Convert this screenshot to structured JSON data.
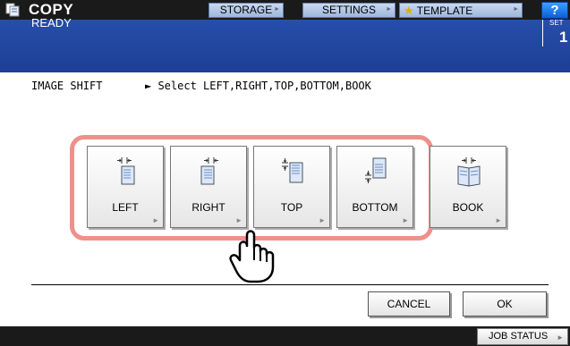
{
  "header": {
    "title": "COPY",
    "buttons": [
      {
        "label": "STORAGE",
        "has_arrow": true
      },
      {
        "label": "SETTINGS",
        "has_arrow": true
      },
      {
        "label": "TEMPLATE",
        "icon": "star-icon",
        "has_arrow": true
      }
    ],
    "help_label": "?"
  },
  "status": {
    "text": "READY",
    "set_label": "SET",
    "set_value": "1"
  },
  "instruction": {
    "label": "IMAGE SHIFT",
    "text": "► Select LEFT,RIGHT,TOP,BOTTOM,BOOK"
  },
  "shift_options": [
    {
      "label": "LEFT",
      "icon": "shift-left-icon",
      "highlighted": true
    },
    {
      "label": "RIGHT",
      "icon": "shift-right-icon",
      "highlighted": true
    },
    {
      "label": "TOP",
      "icon": "shift-top-icon",
      "highlighted": true
    },
    {
      "label": "BOTTOM",
      "icon": "shift-bottom-icon",
      "highlighted": true
    },
    {
      "label": "BOOK",
      "icon": "book-icon",
      "highlighted": false
    }
  ],
  "actions": {
    "cancel_label": "CANCEL",
    "ok_label": "OK"
  },
  "footer": {
    "job_status_label": "JOB STATUS"
  },
  "colors": {
    "status_band": "#264eaa",
    "highlight_border": "#f0908a",
    "help_button": "#1a78e8"
  }
}
